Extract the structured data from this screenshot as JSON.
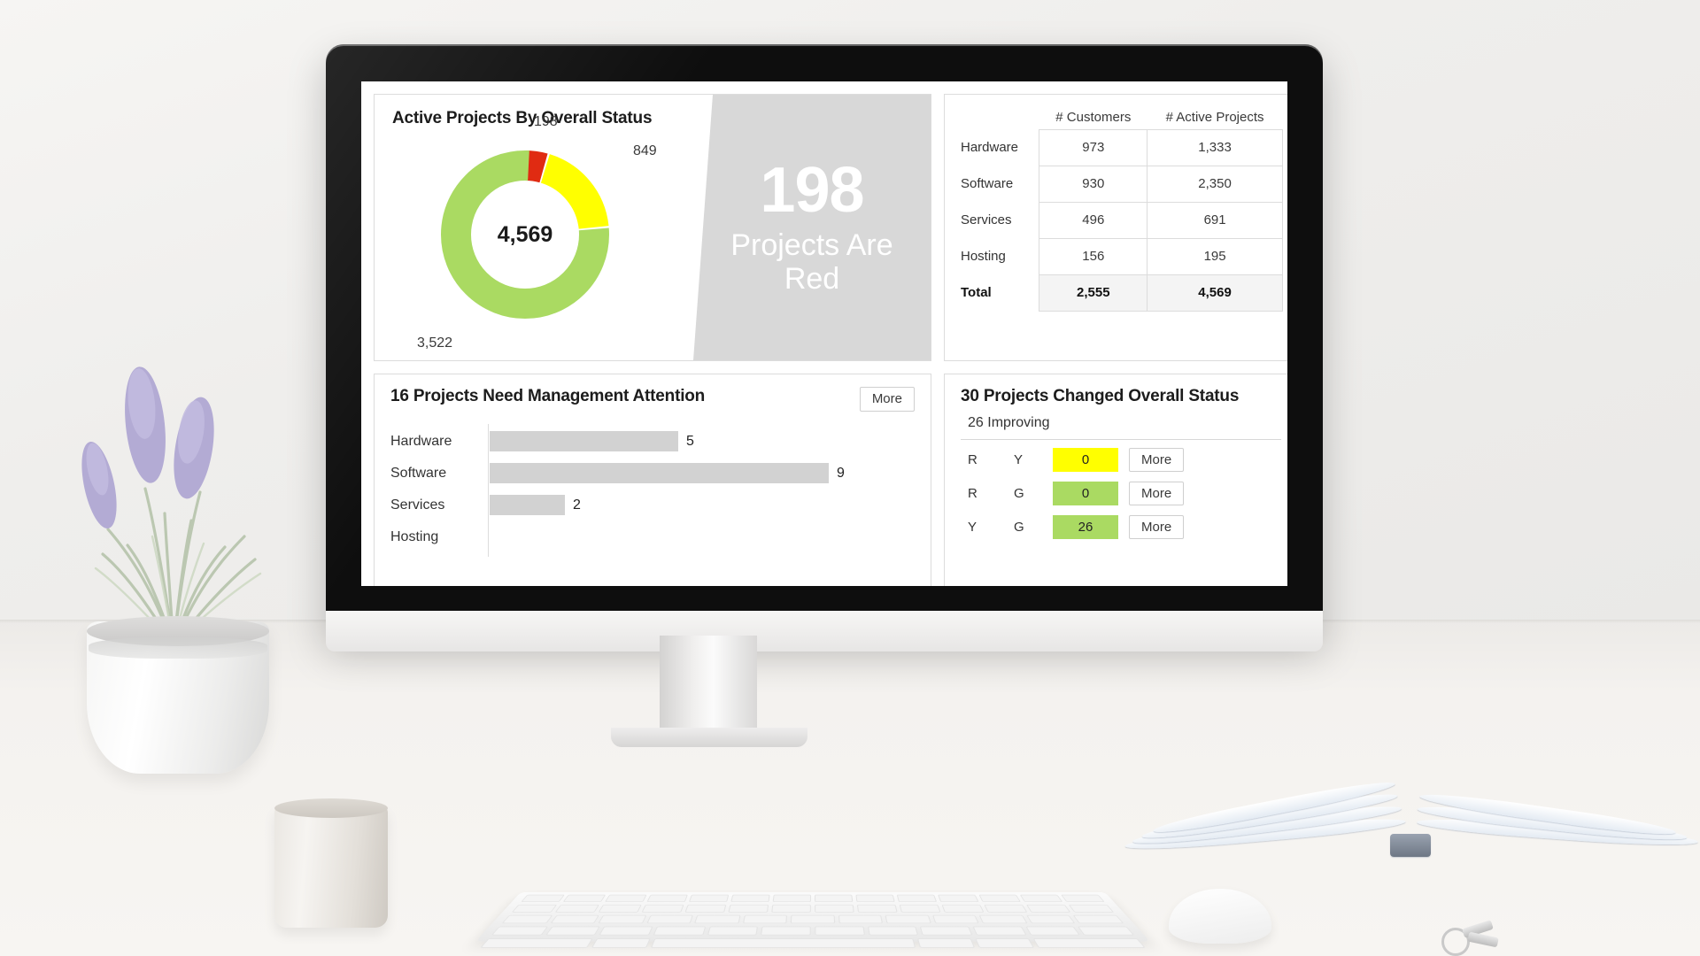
{
  "scene": {
    "objects": [
      "monitor",
      "lavender-plant",
      "concrete-mug",
      "keyboard",
      "mouse",
      "open-book",
      "keys"
    ]
  },
  "dashboard": {
    "donut_card": {
      "title": "Active Projects By Overall Status",
      "center_total": "4,569",
      "labels": {
        "red": "198",
        "yellow": "849",
        "green": "3,522"
      },
      "kpi": {
        "number": "198",
        "caption": "Projects Are Red"
      }
    },
    "table_card": {
      "col_headers": [
        "",
        "# Customers",
        "# Active Projects"
      ],
      "rows": [
        {
          "label": "Hardware",
          "customers": "973",
          "active_projects": "1,333"
        },
        {
          "label": "Software",
          "customers": "930",
          "active_projects": "2,350"
        },
        {
          "label": "Services",
          "customers": "496",
          "active_projects": "691"
        },
        {
          "label": "Hosting",
          "customers": "156",
          "active_projects": "195"
        }
      ],
      "total": {
        "label": "Total",
        "customers": "2,555",
        "active_projects": "4,569"
      }
    },
    "attention_card": {
      "title": "16 Projects Need Management Attention",
      "more_label": "More",
      "bars": [
        {
          "label": "Hardware",
          "value": "5"
        },
        {
          "label": "Software",
          "value": "9"
        },
        {
          "label": "Services",
          "value": "2"
        },
        {
          "label": "Hosting",
          "value": ""
        }
      ]
    },
    "change_card": {
      "title": "30 Projects Changed Overall Status",
      "subtitle": "26 Improving",
      "rows": [
        {
          "from": "R",
          "to": "Y",
          "count": "0",
          "more_label": "More",
          "swatch": "#ffff00"
        },
        {
          "from": "R",
          "to": "G",
          "count": "0",
          "more_label": "More",
          "swatch": "#aada62"
        },
        {
          "from": "Y",
          "to": "G",
          "count": "26",
          "more_label": "More",
          "swatch": "#aada62"
        }
      ]
    }
  },
  "chart_data": {
    "type": "pie",
    "title": "Active Projects By Overall Status",
    "labels": [
      "Green",
      "Yellow",
      "Red"
    ],
    "values": [
      3522,
      849,
      198
    ],
    "colors": [
      "#aada62",
      "#ffff00",
      "#e02b12"
    ],
    "total": 4569,
    "center_label": "4,569",
    "legend": "none",
    "notes": "Donut chart; segments drawn clockwise from top: Red 198, Yellow 849, Green 3,522"
  },
  "colors": {
    "green": "#aada62",
    "yellow": "#ffff00",
    "red": "#e02b12",
    "bar_gray": "#d2d2d2",
    "kpi_panel": "#d8d8d8",
    "border": "#dcdcdc"
  }
}
